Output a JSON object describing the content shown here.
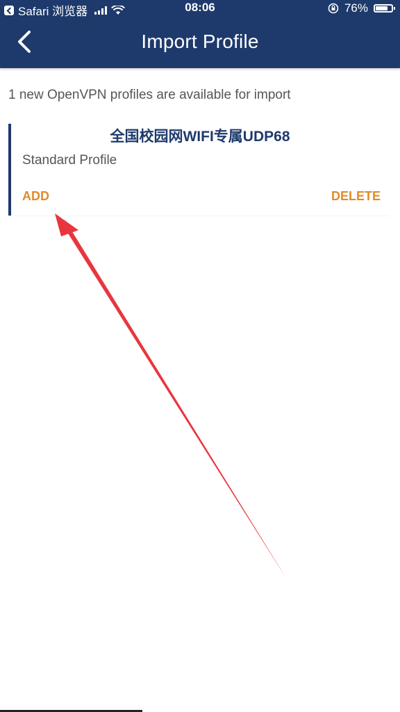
{
  "status_bar": {
    "app": "Safari 浏览器",
    "time": "08:06",
    "battery": "76%",
    "battery_level": 0.76
  },
  "header": {
    "title": "Import Profile",
    "back_icon": "chevron-left-icon"
  },
  "main": {
    "subtitle": "1 new OpenVPN profiles are available for import",
    "profile": {
      "name": "全国校园网WIFI专属UDP68",
      "type": "Standard Profile",
      "add_label": "ADD",
      "delete_label": "DELETE"
    }
  },
  "colors": {
    "header_bg": "#1e3a6c",
    "accent": "#e28b2a",
    "annotation_arrow": "#e8363f"
  }
}
